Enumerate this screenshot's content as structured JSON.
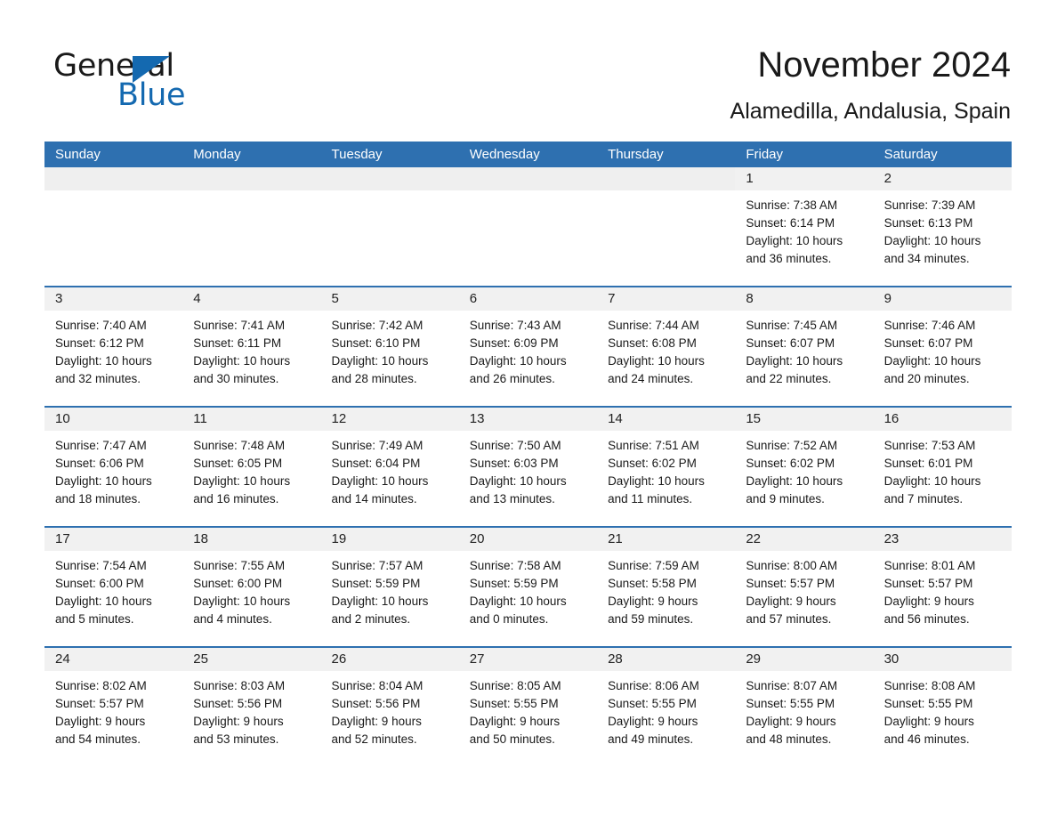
{
  "logo": {
    "word_one": "General",
    "word_two": "Blue",
    "accent_color": "#1469b0",
    "triangle_icon": "triangle-icon"
  },
  "header": {
    "title": "November 2024",
    "subtitle": "Alamedilla, Andalusia, Spain"
  },
  "theme": {
    "header_blue": "#2e70b0",
    "band_gray": "#f1f1f1",
    "text_dark": "#1a1a1a"
  },
  "weekdays": [
    "Sunday",
    "Monday",
    "Tuesday",
    "Wednesday",
    "Thursday",
    "Friday",
    "Saturday"
  ],
  "weeks": [
    [
      {
        "day": "",
        "lines": []
      },
      {
        "day": "",
        "lines": []
      },
      {
        "day": "",
        "lines": []
      },
      {
        "day": "",
        "lines": []
      },
      {
        "day": "",
        "lines": []
      },
      {
        "day": "1",
        "lines": [
          "Sunrise: 7:38 AM",
          "Sunset: 6:14 PM",
          "Daylight: 10 hours",
          "and 36 minutes."
        ]
      },
      {
        "day": "2",
        "lines": [
          "Sunrise: 7:39 AM",
          "Sunset: 6:13 PM",
          "Daylight: 10 hours",
          "and 34 minutes."
        ]
      }
    ],
    [
      {
        "day": "3",
        "lines": [
          "Sunrise: 7:40 AM",
          "Sunset: 6:12 PM",
          "Daylight: 10 hours",
          "and 32 minutes."
        ]
      },
      {
        "day": "4",
        "lines": [
          "Sunrise: 7:41 AM",
          "Sunset: 6:11 PM",
          "Daylight: 10 hours",
          "and 30 minutes."
        ]
      },
      {
        "day": "5",
        "lines": [
          "Sunrise: 7:42 AM",
          "Sunset: 6:10 PM",
          "Daylight: 10 hours",
          "and 28 minutes."
        ]
      },
      {
        "day": "6",
        "lines": [
          "Sunrise: 7:43 AM",
          "Sunset: 6:09 PM",
          "Daylight: 10 hours",
          "and 26 minutes."
        ]
      },
      {
        "day": "7",
        "lines": [
          "Sunrise: 7:44 AM",
          "Sunset: 6:08 PM",
          "Daylight: 10 hours",
          "and 24 minutes."
        ]
      },
      {
        "day": "8",
        "lines": [
          "Sunrise: 7:45 AM",
          "Sunset: 6:07 PM",
          "Daylight: 10 hours",
          "and 22 minutes."
        ]
      },
      {
        "day": "9",
        "lines": [
          "Sunrise: 7:46 AM",
          "Sunset: 6:07 PM",
          "Daylight: 10 hours",
          "and 20 minutes."
        ]
      }
    ],
    [
      {
        "day": "10",
        "lines": [
          "Sunrise: 7:47 AM",
          "Sunset: 6:06 PM",
          "Daylight: 10 hours",
          "and 18 minutes."
        ]
      },
      {
        "day": "11",
        "lines": [
          "Sunrise: 7:48 AM",
          "Sunset: 6:05 PM",
          "Daylight: 10 hours",
          "and 16 minutes."
        ]
      },
      {
        "day": "12",
        "lines": [
          "Sunrise: 7:49 AM",
          "Sunset: 6:04 PM",
          "Daylight: 10 hours",
          "and 14 minutes."
        ]
      },
      {
        "day": "13",
        "lines": [
          "Sunrise: 7:50 AM",
          "Sunset: 6:03 PM",
          "Daylight: 10 hours",
          "and 13 minutes."
        ]
      },
      {
        "day": "14",
        "lines": [
          "Sunrise: 7:51 AM",
          "Sunset: 6:02 PM",
          "Daylight: 10 hours",
          "and 11 minutes."
        ]
      },
      {
        "day": "15",
        "lines": [
          "Sunrise: 7:52 AM",
          "Sunset: 6:02 PM",
          "Daylight: 10 hours",
          "and 9 minutes."
        ]
      },
      {
        "day": "16",
        "lines": [
          "Sunrise: 7:53 AM",
          "Sunset: 6:01 PM",
          "Daylight: 10 hours",
          "and 7 minutes."
        ]
      }
    ],
    [
      {
        "day": "17",
        "lines": [
          "Sunrise: 7:54 AM",
          "Sunset: 6:00 PM",
          "Daylight: 10 hours",
          "and 5 minutes."
        ]
      },
      {
        "day": "18",
        "lines": [
          "Sunrise: 7:55 AM",
          "Sunset: 6:00 PM",
          "Daylight: 10 hours",
          "and 4 minutes."
        ]
      },
      {
        "day": "19",
        "lines": [
          "Sunrise: 7:57 AM",
          "Sunset: 5:59 PM",
          "Daylight: 10 hours",
          "and 2 minutes."
        ]
      },
      {
        "day": "20",
        "lines": [
          "Sunrise: 7:58 AM",
          "Sunset: 5:59 PM",
          "Daylight: 10 hours",
          "and 0 minutes."
        ]
      },
      {
        "day": "21",
        "lines": [
          "Sunrise: 7:59 AM",
          "Sunset: 5:58 PM",
          "Daylight: 9 hours",
          "and 59 minutes."
        ]
      },
      {
        "day": "22",
        "lines": [
          "Sunrise: 8:00 AM",
          "Sunset: 5:57 PM",
          "Daylight: 9 hours",
          "and 57 minutes."
        ]
      },
      {
        "day": "23",
        "lines": [
          "Sunrise: 8:01 AM",
          "Sunset: 5:57 PM",
          "Daylight: 9 hours",
          "and 56 minutes."
        ]
      }
    ],
    [
      {
        "day": "24",
        "lines": [
          "Sunrise: 8:02 AM",
          "Sunset: 5:57 PM",
          "Daylight: 9 hours",
          "and 54 minutes."
        ]
      },
      {
        "day": "25",
        "lines": [
          "Sunrise: 8:03 AM",
          "Sunset: 5:56 PM",
          "Daylight: 9 hours",
          "and 53 minutes."
        ]
      },
      {
        "day": "26",
        "lines": [
          "Sunrise: 8:04 AM",
          "Sunset: 5:56 PM",
          "Daylight: 9 hours",
          "and 52 minutes."
        ]
      },
      {
        "day": "27",
        "lines": [
          "Sunrise: 8:05 AM",
          "Sunset: 5:55 PM",
          "Daylight: 9 hours",
          "and 50 minutes."
        ]
      },
      {
        "day": "28",
        "lines": [
          "Sunrise: 8:06 AM",
          "Sunset: 5:55 PM",
          "Daylight: 9 hours",
          "and 49 minutes."
        ]
      },
      {
        "day": "29",
        "lines": [
          "Sunrise: 8:07 AM",
          "Sunset: 5:55 PM",
          "Daylight: 9 hours",
          "and 48 minutes."
        ]
      },
      {
        "day": "30",
        "lines": [
          "Sunrise: 8:08 AM",
          "Sunset: 5:55 PM",
          "Daylight: 9 hours",
          "and 46 minutes."
        ]
      }
    ]
  ]
}
